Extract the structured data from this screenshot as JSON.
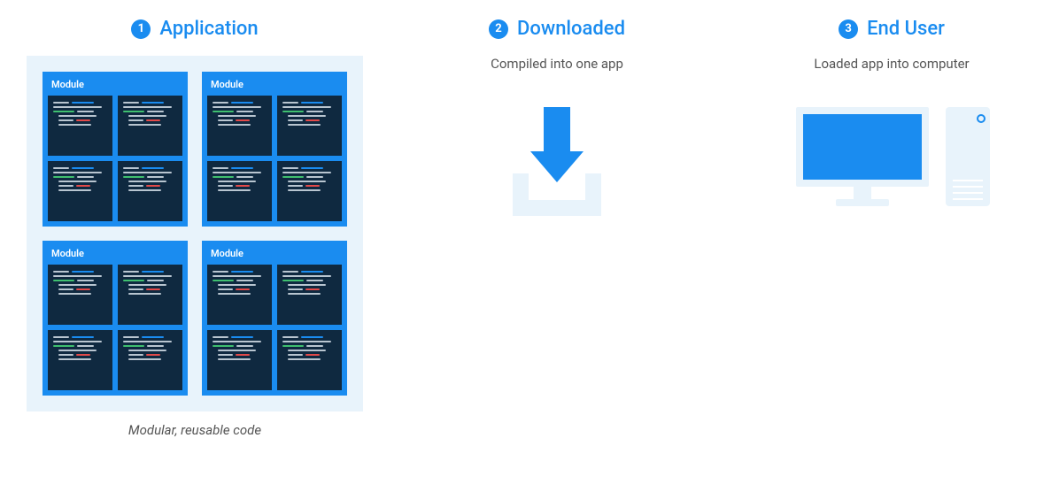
{
  "columns": {
    "app": {
      "number": "1",
      "title": "Application",
      "module_label": "Module",
      "caption": "Modular, reusable code"
    },
    "download": {
      "number": "2",
      "title": "Downloaded",
      "subtitle": "Compiled into one app"
    },
    "enduser": {
      "number": "3",
      "title": "End User",
      "subtitle": "Loaded app into computer"
    }
  },
  "colors": {
    "accent": "#1a8cf0",
    "light": "#e8f3fb",
    "dark": "#0f2940"
  }
}
